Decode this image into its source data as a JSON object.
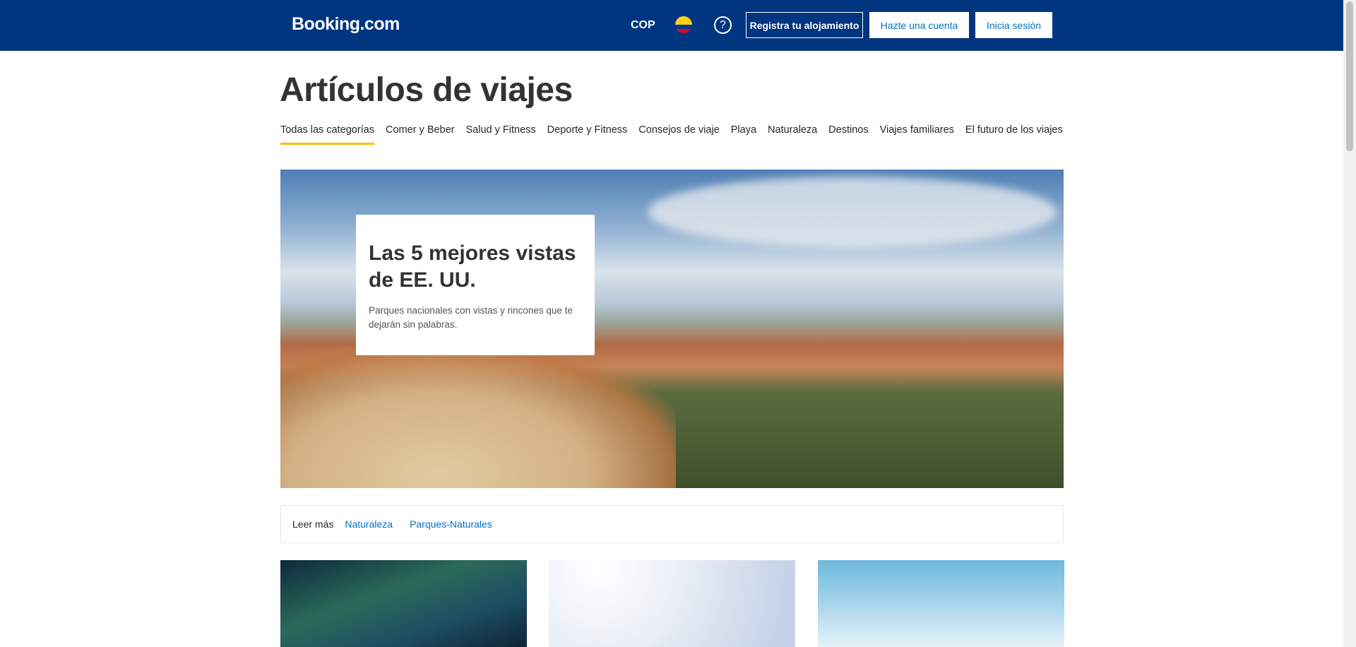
{
  "header": {
    "logo": "Booking.com",
    "currency": "COP",
    "help": "?",
    "register_property": "Registra tu alojamiento",
    "create_account": "Hazte una cuenta",
    "sign_in": "Inicia sesión"
  },
  "page": {
    "title": "Artículos de viajes"
  },
  "tabs": [
    "Todas las categorías",
    "Comer y Beber",
    "Salud y Fitness",
    "Deporte y Fitness",
    "Consejos de viaje",
    "Playa",
    "Naturaleza",
    "Destinos",
    "Viajes familiares",
    "El futuro de los viajes"
  ],
  "hero": {
    "title": "Las 5 mejores vistas de EE. UU.",
    "subtitle": "Parques nacionales con vistas y rincones que te dejarán sin palabras."
  },
  "read_more": {
    "label": "Leer más",
    "links": [
      "Naturaleza",
      "Parques-Naturales"
    ]
  },
  "colors": {
    "brand": "#003580",
    "accent": "#febb02",
    "link": "#0071c2"
  }
}
